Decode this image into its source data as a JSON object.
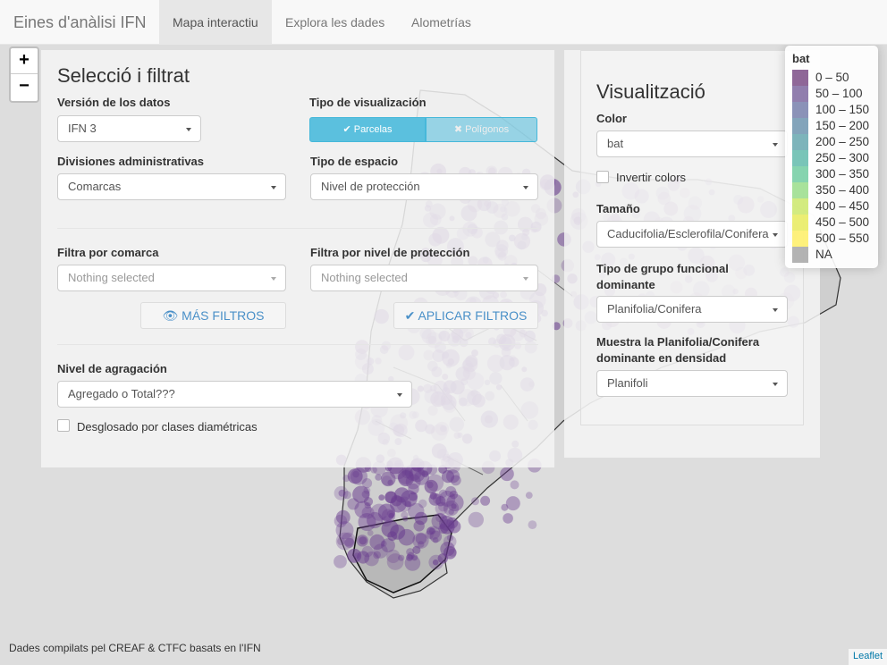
{
  "navbar": {
    "brand": "Eines d'anàlisi IFN",
    "tabs": [
      {
        "label": "Mapa interactiu",
        "active": true
      },
      {
        "label": "Explora les dades",
        "active": false
      },
      {
        "label": "Alometrías",
        "active": false
      }
    ]
  },
  "zoom": {
    "in": "+",
    "out": "−"
  },
  "left_panel": {
    "title": "Selecció i filtrat",
    "version": {
      "label": "Versión de los datos",
      "value": "IFN 3"
    },
    "viz_type": {
      "label": "Tipo de visualización",
      "option_a": "✔ Parcelas",
      "option_b": "✖ Polígonos"
    },
    "admin_div": {
      "label": "Divisiones administrativas",
      "value": "Comarcas"
    },
    "space_type": {
      "label": "Tipo de espacio",
      "value": "Nivel de protección"
    },
    "filter_comarca": {
      "label": "Filtra por comarca",
      "placeholder": "Nothing selected"
    },
    "filter_protection": {
      "label": "Filtra por nivel de protección",
      "placeholder": "Nothing selected"
    },
    "more_filters": "👁 MÁS FILTROS",
    "apply_filters": "✔ APLICAR FILTROS",
    "aggregation": {
      "label": "Nivel de agragación",
      "value": "Agregado o Total???"
    },
    "breakdown_label": "Desglosado por clases diamétricas"
  },
  "right_panel": {
    "title": "Visualització",
    "color": {
      "label": "Color",
      "value": "bat"
    },
    "invert_label": "Invertir colors",
    "size": {
      "label": "Tamaño",
      "value": "Caducifolia/Esclerofila/Conifera"
    },
    "functional_group": {
      "label": "Tipo de grupo funcional dominante",
      "value": "Planifolia/Conifera"
    },
    "density": {
      "label": "Muestra la Planifolia/Conifera dominante en densidad",
      "value": "Planifoli"
    }
  },
  "legend": {
    "title": "bat",
    "items": [
      {
        "label": "0 – 50",
        "color": "#440154"
      },
      {
        "label": "50 – 100",
        "color": "#482878"
      },
      {
        "label": "100 – 150",
        "color": "#3e4989"
      },
      {
        "label": "150 – 200",
        "color": "#31688e"
      },
      {
        "label": "200 – 250",
        "color": "#26828e"
      },
      {
        "label": "250 – 300",
        "color": "#1f9e89"
      },
      {
        "label": "300 – 350",
        "color": "#35b779"
      },
      {
        "label": "350 – 400",
        "color": "#6ece58"
      },
      {
        "label": "400 – 450",
        "color": "#b5de2b"
      },
      {
        "label": "450 – 500",
        "color": "#dde318"
      },
      {
        "label": "500 – 550",
        "color": "#fde725"
      },
      {
        "label": "NA",
        "color": "#808080"
      }
    ]
  },
  "attribution": {
    "left": "Dades compilats pel CREAF & CTFC basats en l'IFN",
    "right": "Leaflet"
  },
  "colors": {
    "points": "#6a3d8f",
    "toggle_active": "#5bc0de",
    "link": "#4a90c8"
  }
}
